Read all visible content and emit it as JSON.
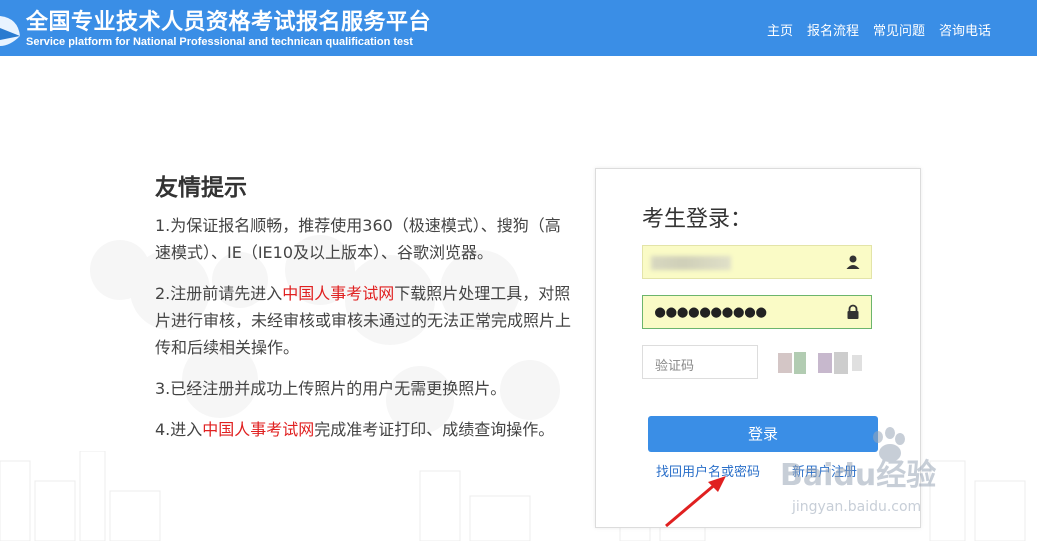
{
  "header": {
    "title_cn": "全国专业技术人员资格考试报名服务平台",
    "title_en": "Service platform for National Professional and technican qualification test",
    "nav": [
      "主页",
      "报名流程",
      "常见问题",
      "咨询电话"
    ]
  },
  "tips": {
    "heading": "友情提示",
    "item1": "1.为保证报名顺畅，推荐使用360（极速模式）、搜狗（高速模式）、IE（IE10及以上版本）、谷歌浏览器。",
    "item2_pre": "2.注册前请先进入",
    "item2_link": "中国人事考试网",
    "item2_post": "下载照片处理工具，对照片进行审核，未经审核或审核未通过的无法正常完成照片上传和后续相关操作。",
    "item3": "3.已经注册并成功上传照片的用户无需更换照片。",
    "item4_pre": "4.进入",
    "item4_link": "中国人事考试网",
    "item4_post": "完成准考证打印、成绩查询操作。"
  },
  "login": {
    "title": "考生登录：",
    "password_mask": "●●●●●●●●●●",
    "captcha_placeholder": "验证码",
    "submit_label": "登录",
    "forgot_link": "找回用户名或密码",
    "register_link": "新用户注册"
  },
  "watermark": {
    "brand": "Baidu经验",
    "url": "jingyan.baidu.com"
  },
  "colors": {
    "header_bg": "#3a8ee6",
    "link_red": "#e02020",
    "link_blue": "#2a6fc9",
    "field_bg": "#fafbc6"
  },
  "icons": {
    "user_field": "user-icon",
    "password_field": "lock-icon",
    "logo": "logo-icon",
    "annotation": "red-arrow"
  }
}
